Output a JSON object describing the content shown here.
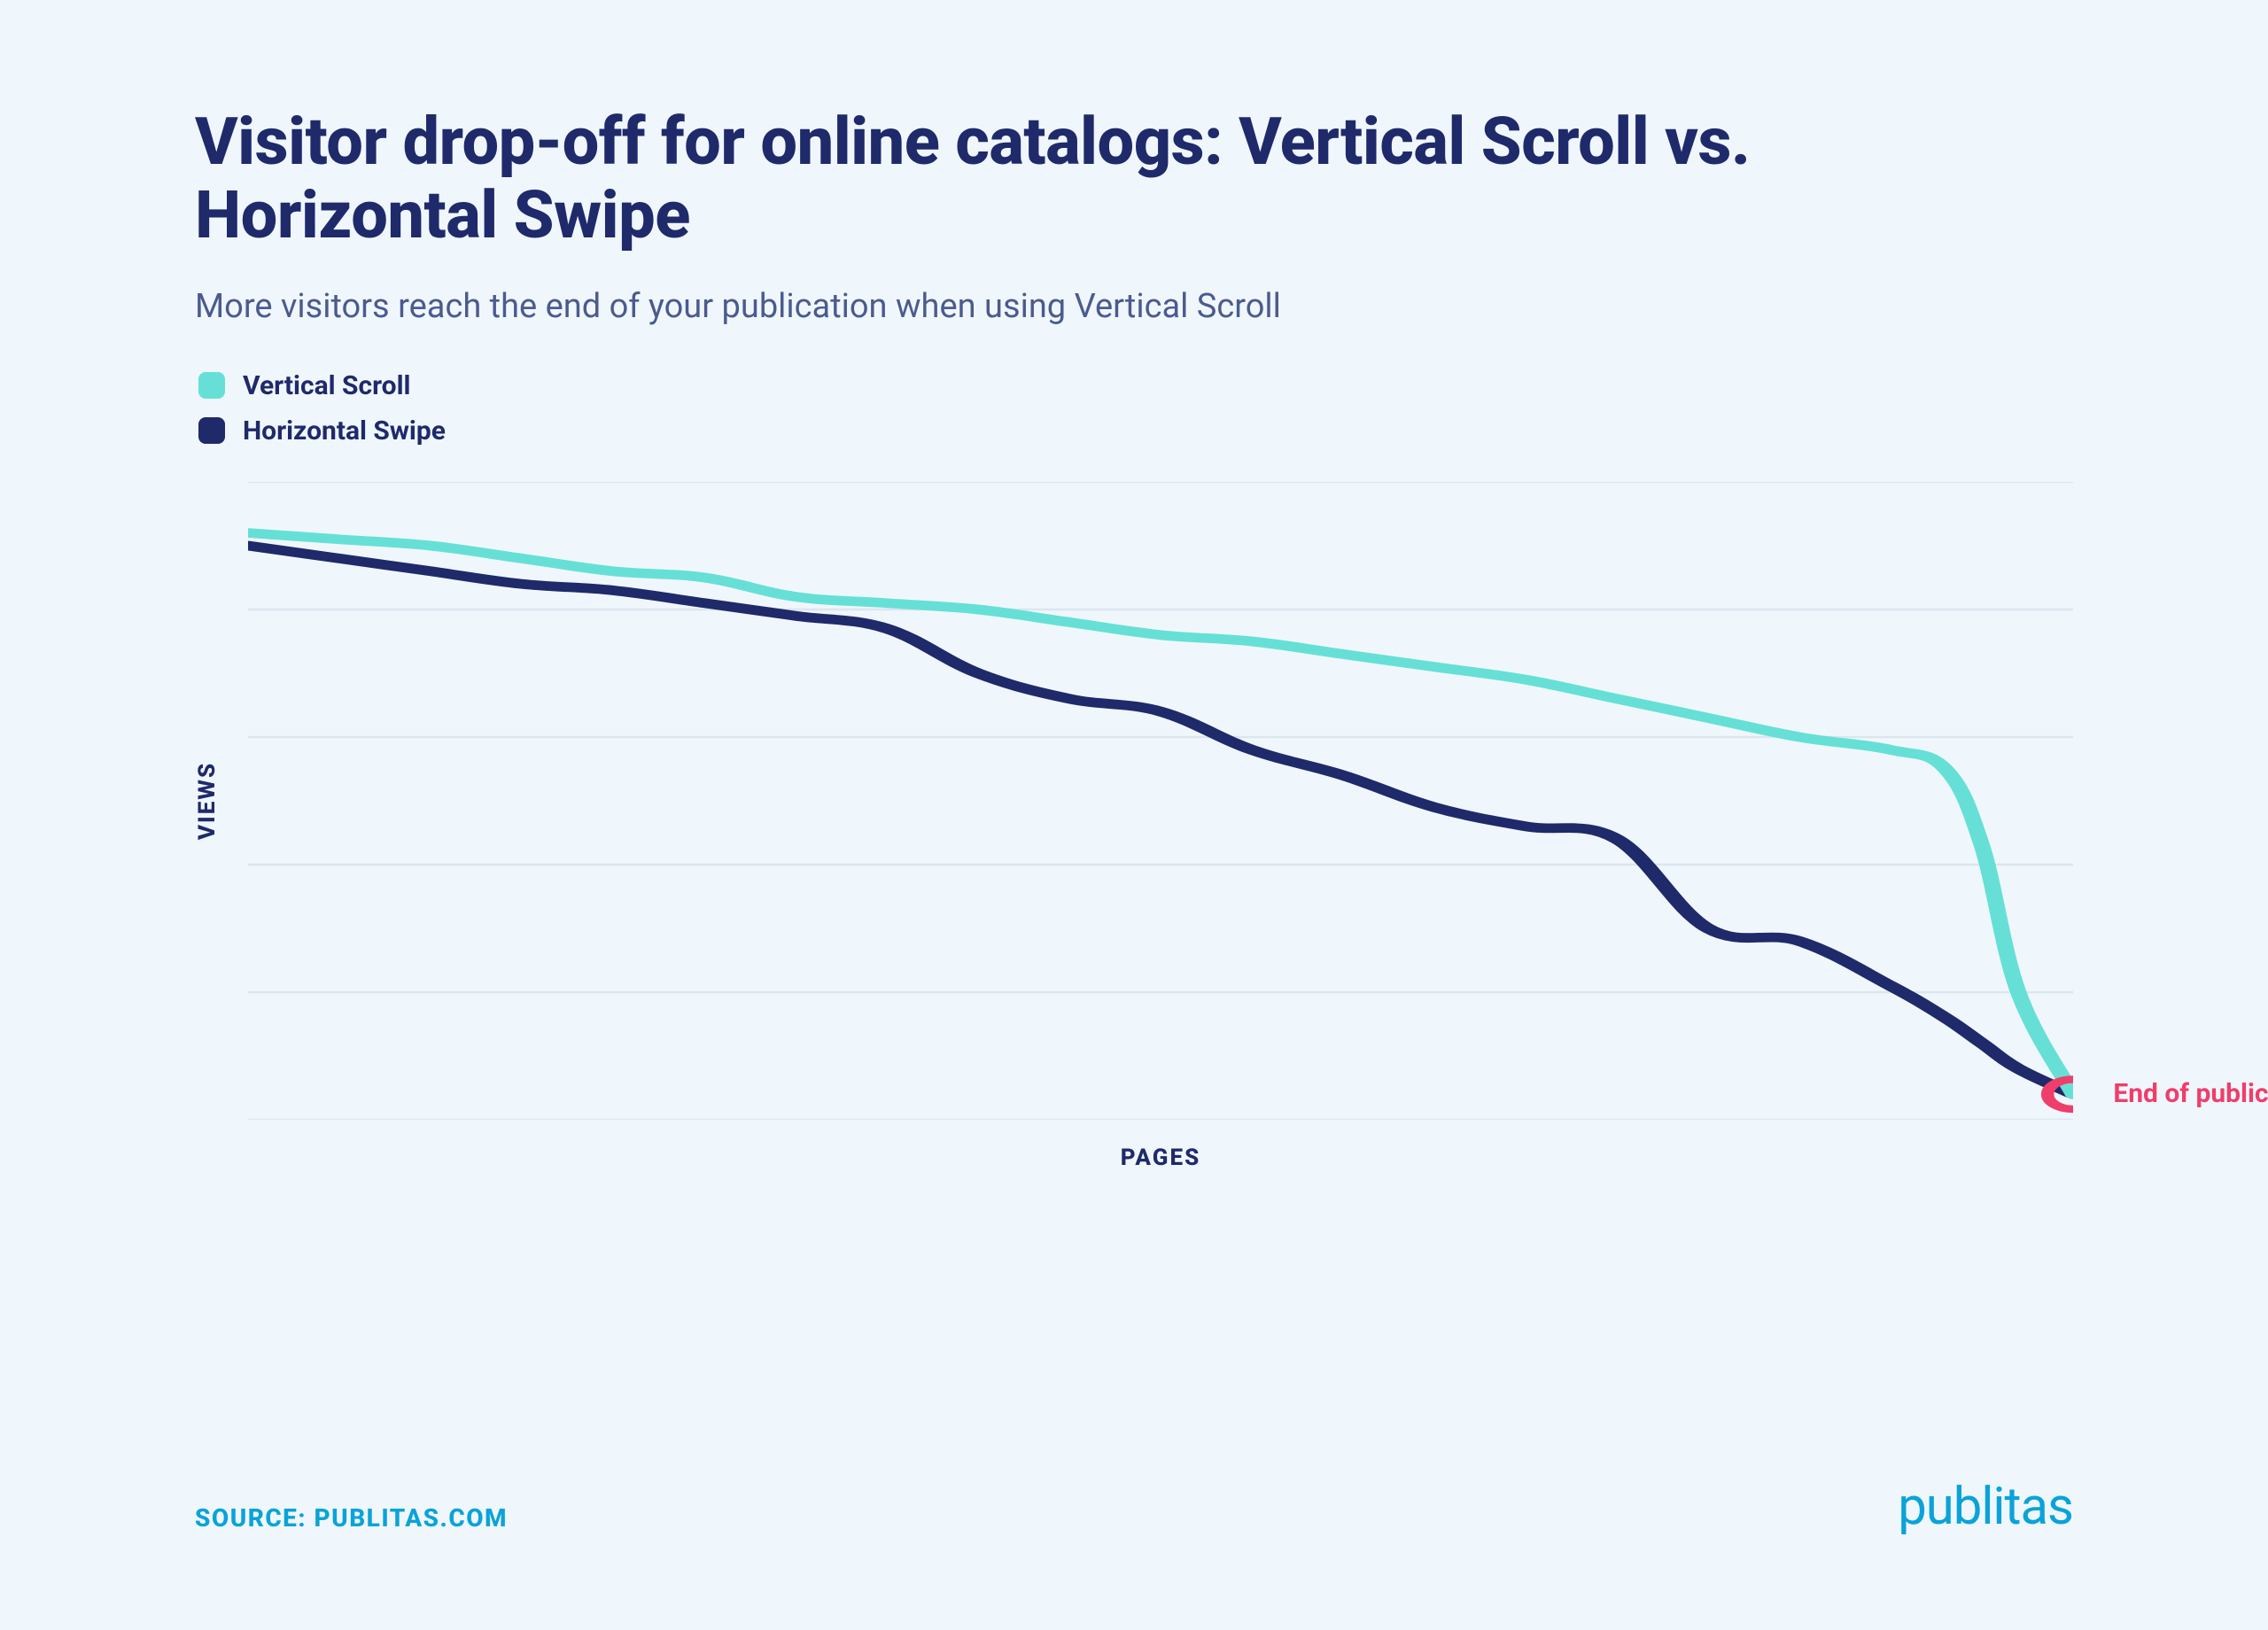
{
  "title": "Visitor drop-off for online catalogs: Vertical Scroll vs. Horizontal Swipe",
  "subtitle": "More visitors reach the end of your publication when using Vertical Scroll",
  "legend": {
    "vertical": "Vertical Scroll",
    "horizontal": "Horizontal Swipe"
  },
  "axes": {
    "x": "PAGES",
    "y": "VIEWS"
  },
  "annotation": "End of publication",
  "source": "SOURCE: PUBLITAS.COM",
  "brand": "publitas",
  "colors": {
    "vertical": "#66e0d6",
    "horizontal": "#1f2a6b",
    "accent": "#ef3e6a",
    "grid": "#dbe6ef",
    "brand": "#0aa3d9"
  },
  "chart_data": {
    "type": "line",
    "title": "Visitor drop-off for online catalogs: Vertical Scroll vs. Horizontal Swipe",
    "xlabel": "PAGES",
    "ylabel": "VIEWS",
    "xlim": [
      0,
      100
    ],
    "ylim": [
      0,
      100
    ],
    "grid_y": [
      0,
      20,
      40,
      60,
      80,
      100
    ],
    "x": [
      0,
      5,
      10,
      15,
      20,
      25,
      30,
      35,
      40,
      45,
      50,
      55,
      60,
      65,
      70,
      75,
      80,
      85,
      90,
      93,
      95,
      97,
      100
    ],
    "series": [
      {
        "name": "Vertical Scroll",
        "color": "#66e0d6",
        "values": [
          92,
          91,
          90,
          88,
          86,
          85,
          82,
          81,
          80,
          78,
          76,
          75,
          73,
          71,
          69,
          66,
          63,
          60,
          58,
          55,
          43,
          20,
          4
        ]
      },
      {
        "name": "Horizontal Swipe",
        "color": "#1f2a6b",
        "values": [
          90,
          88,
          86,
          84,
          83,
          81,
          79,
          77,
          70,
          66,
          64,
          58,
          54,
          49,
          46,
          44,
          30,
          28,
          21,
          16,
          12,
          8,
          4
        ]
      }
    ],
    "end_point": {
      "x": 100,
      "y": 4,
      "label": "End of publication"
    }
  }
}
